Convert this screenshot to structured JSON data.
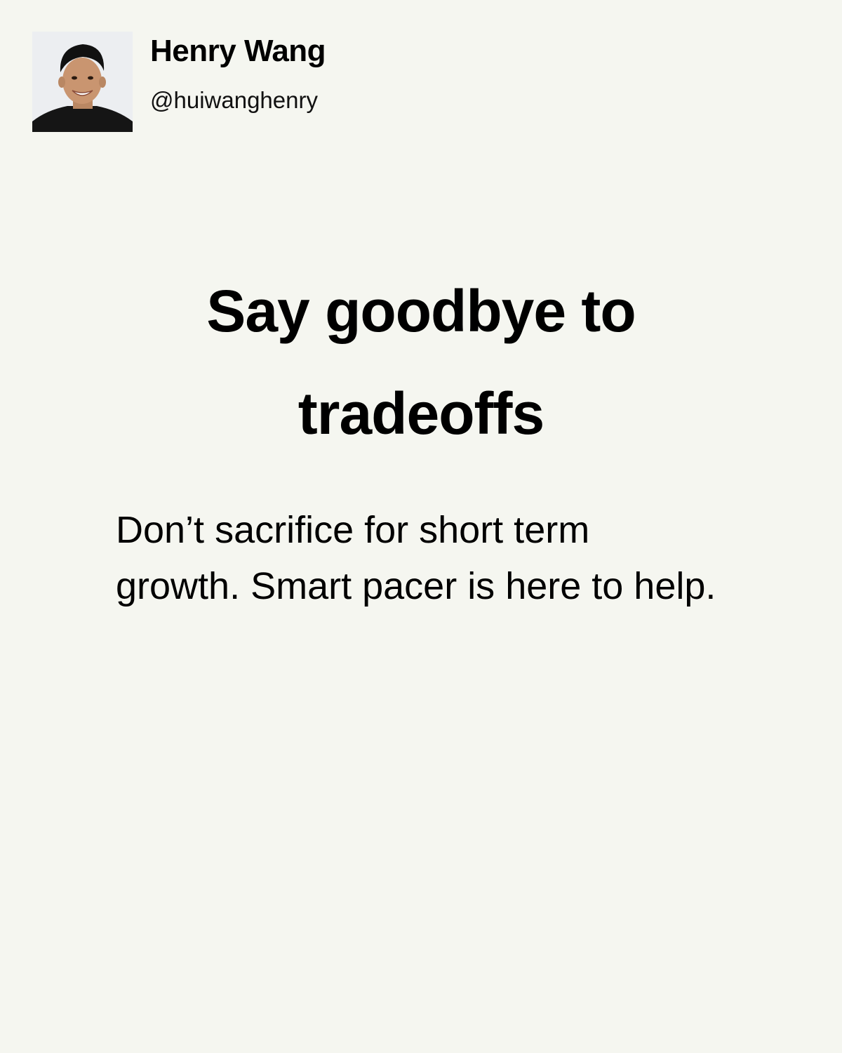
{
  "author": {
    "name": "Henry Wang",
    "handle": "@huiwanghenry"
  },
  "post": {
    "headline_line1": "Say goodbye to",
    "headline_line2": "tradeoffs",
    "body": "Don’t sacrifice for short term growth. Smart pacer is here to help."
  },
  "colors": {
    "background": "#f5f6f0",
    "text": "#000000"
  },
  "icons": {
    "avatar": "profile-photo"
  }
}
